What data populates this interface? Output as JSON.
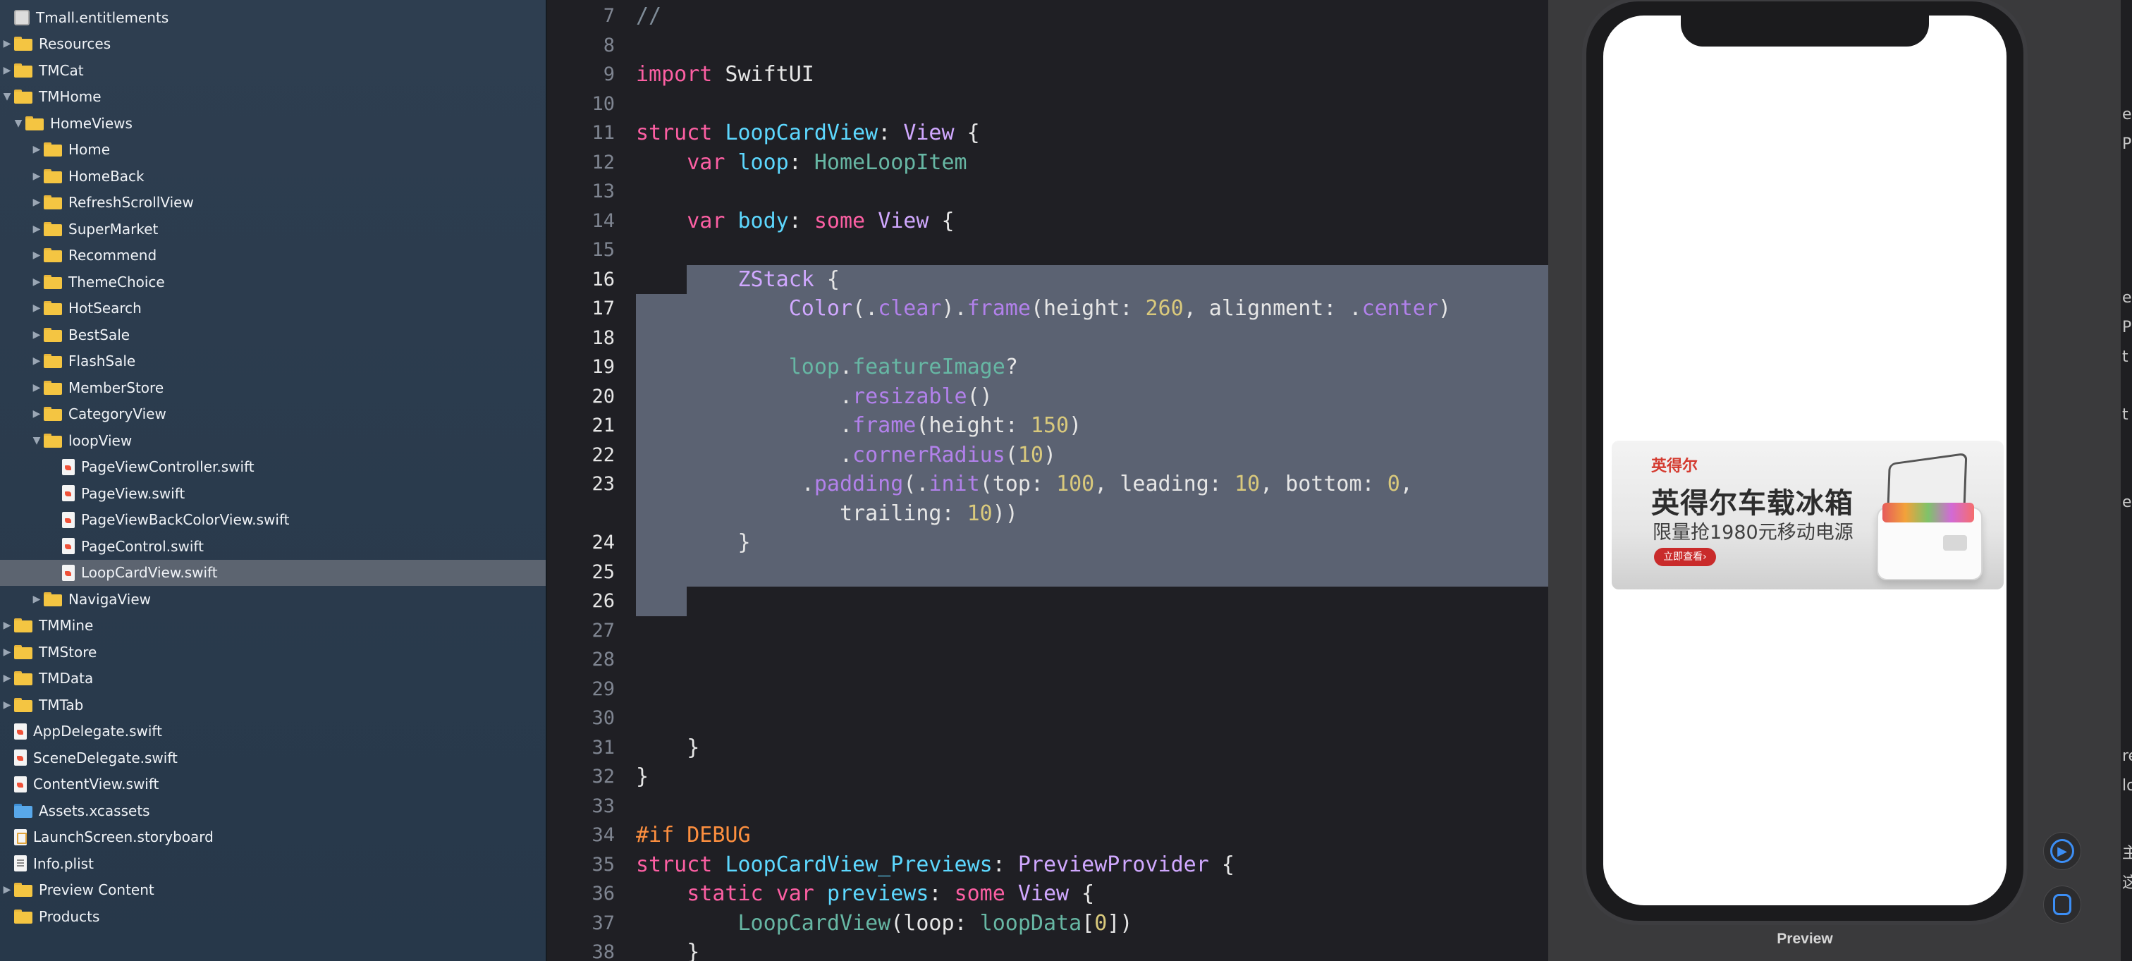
{
  "navigator": {
    "items": [
      {
        "label": "Tmall.entitlements",
        "indent": 0,
        "icon": "entitlements-icon",
        "disclosure": "none"
      },
      {
        "label": "Resources",
        "indent": 0,
        "icon": "folder-icon",
        "disclosure": "collapsed"
      },
      {
        "label": "TMCat",
        "indent": 0,
        "icon": "folder-icon",
        "disclosure": "collapsed"
      },
      {
        "label": "TMHome",
        "indent": 0,
        "icon": "folder-icon",
        "disclosure": "expanded"
      },
      {
        "label": "HomeViews",
        "indent": 1,
        "icon": "folder-icon",
        "disclosure": "expanded"
      },
      {
        "label": "Home",
        "indent": 2,
        "icon": "folder-icon",
        "disclosure": "collapsed"
      },
      {
        "label": "HomeBack",
        "indent": 2,
        "icon": "folder-icon",
        "disclosure": "collapsed"
      },
      {
        "label": "RefreshScrollView",
        "indent": 2,
        "icon": "folder-icon",
        "disclosure": "collapsed"
      },
      {
        "label": "SuperMarket",
        "indent": 2,
        "icon": "folder-icon",
        "disclosure": "collapsed"
      },
      {
        "label": "Recommend",
        "indent": 2,
        "icon": "folder-icon",
        "disclosure": "collapsed"
      },
      {
        "label": "ThemeChoice",
        "indent": 2,
        "icon": "folder-icon",
        "disclosure": "collapsed"
      },
      {
        "label": "HotSearch",
        "indent": 2,
        "icon": "folder-icon",
        "disclosure": "collapsed"
      },
      {
        "label": "BestSale",
        "indent": 2,
        "icon": "folder-icon",
        "disclosure": "collapsed"
      },
      {
        "label": "FlashSale",
        "indent": 2,
        "icon": "folder-icon",
        "disclosure": "collapsed"
      },
      {
        "label": "MemberStore",
        "indent": 2,
        "icon": "folder-icon",
        "disclosure": "collapsed"
      },
      {
        "label": "CategoryView",
        "indent": 2,
        "icon": "folder-icon",
        "disclosure": "collapsed"
      },
      {
        "label": "loopView",
        "indent": 2,
        "icon": "folder-icon",
        "disclosure": "expanded"
      },
      {
        "label": "PageViewController.swift",
        "indent": 3,
        "icon": "swift-file-icon",
        "disclosure": "none"
      },
      {
        "label": "PageView.swift",
        "indent": 3,
        "icon": "swift-file-icon",
        "disclosure": "none"
      },
      {
        "label": "PageViewBackColorView.swift",
        "indent": 3,
        "icon": "swift-file-icon",
        "disclosure": "none"
      },
      {
        "label": "PageControl.swift",
        "indent": 3,
        "icon": "swift-file-icon",
        "disclosure": "none"
      },
      {
        "label": "LoopCardView.swift",
        "indent": 3,
        "icon": "swift-file-icon",
        "disclosure": "none",
        "selected": true
      },
      {
        "label": "NavigaView",
        "indent": 2,
        "icon": "folder-icon",
        "disclosure": "collapsed"
      },
      {
        "label": "TMMine",
        "indent": 0,
        "icon": "folder-icon",
        "disclosure": "collapsed"
      },
      {
        "label": "TMStore",
        "indent": 0,
        "icon": "folder-icon",
        "disclosure": "collapsed"
      },
      {
        "label": "TMData",
        "indent": 0,
        "icon": "folder-icon",
        "disclosure": "collapsed"
      },
      {
        "label": "TMTab",
        "indent": 0,
        "icon": "folder-icon",
        "disclosure": "collapsed"
      },
      {
        "label": "AppDelegate.swift",
        "indent": 0,
        "icon": "swift-file-icon",
        "disclosure": "none"
      },
      {
        "label": "SceneDelegate.swift",
        "indent": 0,
        "icon": "swift-file-icon",
        "disclosure": "none"
      },
      {
        "label": "ContentView.swift",
        "indent": 0,
        "icon": "swift-file-icon",
        "disclosure": "none"
      },
      {
        "label": "Assets.xcassets",
        "indent": 0,
        "icon": "asset-catalog-icon",
        "disclosure": "none"
      },
      {
        "label": "LaunchScreen.storyboard",
        "indent": 0,
        "icon": "storyboard-icon",
        "disclosure": "none"
      },
      {
        "label": "Info.plist",
        "indent": 0,
        "icon": "plist-file-icon",
        "disclosure": "none"
      },
      {
        "label": "Preview Content",
        "indent": 0,
        "icon": "folder-icon",
        "disclosure": "collapsed"
      },
      {
        "label": "Products",
        "indent": 0,
        "icon": "folder-icon",
        "disclosure": "none"
      }
    ]
  },
  "editor": {
    "selected_lines": [
      16,
      17,
      18,
      19,
      20,
      21,
      22,
      23,
      24,
      25,
      26
    ],
    "lines": [
      {
        "num": "7",
        "tokens": [
          [
            "cm",
            "//"
          ]
        ]
      },
      {
        "num": "8",
        "tokens": []
      },
      {
        "num": "9",
        "tokens": [
          [
            "kw",
            "import"
          ],
          [
            "pl",
            " SwiftUI"
          ]
        ]
      },
      {
        "num": "10",
        "tokens": []
      },
      {
        "num": "11",
        "tokens": [
          [
            "kw",
            "struct"
          ],
          [
            "pl",
            " "
          ],
          [
            "decl",
            "LoopCardView"
          ],
          [
            "pl",
            ": "
          ],
          [
            "type",
            "View"
          ],
          [
            "pl",
            " {"
          ]
        ]
      },
      {
        "num": "12",
        "tokens": [
          [
            "pl",
            "    "
          ],
          [
            "kw",
            "var"
          ],
          [
            "pl",
            " "
          ],
          [
            "decl",
            "loop"
          ],
          [
            "pl",
            ": "
          ],
          [
            "id",
            "HomeLoopItem"
          ]
        ]
      },
      {
        "num": "13",
        "tokens": []
      },
      {
        "num": "14",
        "tokens": [
          [
            "pl",
            "    "
          ],
          [
            "kw",
            "var"
          ],
          [
            "pl",
            " "
          ],
          [
            "decl",
            "body"
          ],
          [
            "pl",
            ": "
          ],
          [
            "kw",
            "some"
          ],
          [
            "pl",
            " "
          ],
          [
            "type",
            "View"
          ],
          [
            "pl",
            " {"
          ]
        ]
      },
      {
        "num": "15",
        "tokens": []
      },
      {
        "num": "16",
        "tokens": [
          [
            "pl",
            "        "
          ],
          [
            "type",
            "ZStack"
          ],
          [
            "pl",
            " {"
          ]
        ]
      },
      {
        "num": "17",
        "tokens": [
          [
            "pl",
            "            "
          ],
          [
            "type",
            "Color"
          ],
          [
            "pl",
            "(."
          ],
          [
            "mem",
            "clear"
          ],
          [
            "pl",
            ")."
          ],
          [
            "mem",
            "frame"
          ],
          [
            "pl",
            "(height: "
          ],
          [
            "num",
            "260"
          ],
          [
            "pl",
            ", alignment: ."
          ],
          [
            "mem",
            "center"
          ],
          [
            "pl",
            ")"
          ]
        ]
      },
      {
        "num": "18",
        "tokens": []
      },
      {
        "num": "19",
        "tokens": [
          [
            "pl",
            "            "
          ],
          [
            "id",
            "loop"
          ],
          [
            "pl",
            "."
          ],
          [
            "id",
            "featureImage"
          ],
          [
            "pl",
            "?"
          ]
        ]
      },
      {
        "num": "20",
        "tokens": [
          [
            "pl",
            "                ."
          ],
          [
            "mem",
            "resizable"
          ],
          [
            "pl",
            "()"
          ]
        ]
      },
      {
        "num": "21",
        "tokens": [
          [
            "pl",
            "                ."
          ],
          [
            "mem",
            "frame"
          ],
          [
            "pl",
            "(height: "
          ],
          [
            "num",
            "150"
          ],
          [
            "pl",
            ")"
          ]
        ]
      },
      {
        "num": "22",
        "tokens": [
          [
            "pl",
            "                ."
          ],
          [
            "mem",
            "cornerRadius"
          ],
          [
            "pl",
            "("
          ],
          [
            "num",
            "10"
          ],
          [
            "pl",
            ")"
          ]
        ]
      },
      {
        "num": "23",
        "tokens": [
          [
            "pl",
            "             ."
          ],
          [
            "mem",
            "padding"
          ],
          [
            "pl",
            "(."
          ],
          [
            "mem",
            "init"
          ],
          [
            "pl",
            "(top: "
          ],
          [
            "num",
            "100"
          ],
          [
            "pl",
            ", leading: "
          ],
          [
            "num",
            "10"
          ],
          [
            "pl",
            ", bottom: "
          ],
          [
            "num",
            "0"
          ],
          [
            "pl",
            ","
          ]
        ]
      },
      {
        "num": "",
        "tokens": [
          [
            "pl",
            "                trailing: "
          ],
          [
            "num",
            "10"
          ],
          [
            "pl",
            "))"
          ]
        ]
      },
      {
        "num": "24",
        "tokens": [
          [
            "pl",
            "        }"
          ]
        ]
      },
      {
        "num": "25",
        "tokens": []
      },
      {
        "num": "26",
        "tokens": []
      },
      {
        "num": "27",
        "tokens": []
      },
      {
        "num": "28",
        "tokens": []
      },
      {
        "num": "29",
        "tokens": []
      },
      {
        "num": "30",
        "tokens": []
      },
      {
        "num": "31",
        "tokens": [
          [
            "pl",
            "    }"
          ]
        ]
      },
      {
        "num": "32",
        "tokens": [
          [
            "pl",
            "}"
          ]
        ]
      },
      {
        "num": "33",
        "tokens": []
      },
      {
        "num": "34",
        "tokens": [
          [
            "pp",
            "#if DEBUG"
          ]
        ]
      },
      {
        "num": "35",
        "tokens": [
          [
            "kw",
            "struct"
          ],
          [
            "pl",
            " "
          ],
          [
            "decl",
            "LoopCardView_Previews"
          ],
          [
            "pl",
            ": "
          ],
          [
            "type",
            "PreviewProvider"
          ],
          [
            "pl",
            " {"
          ]
        ]
      },
      {
        "num": "36",
        "tokens": [
          [
            "pl",
            "    "
          ],
          [
            "kw",
            "static"
          ],
          [
            "pl",
            " "
          ],
          [
            "kw",
            "var"
          ],
          [
            "pl",
            " "
          ],
          [
            "decl",
            "previews"
          ],
          [
            "pl",
            ": "
          ],
          [
            "kw",
            "some"
          ],
          [
            "pl",
            " "
          ],
          [
            "type",
            "View"
          ],
          [
            "pl",
            " {"
          ]
        ]
      },
      {
        "num": "37",
        "tokens": [
          [
            "pl",
            "        "
          ],
          [
            "id",
            "LoopCardView"
          ],
          [
            "pl",
            "(loop: "
          ],
          [
            "id",
            "loopData"
          ],
          [
            "pl",
            "["
          ],
          [
            "num",
            "0"
          ],
          [
            "pl",
            "])"
          ]
        ]
      },
      {
        "num": "38",
        "tokens": [
          [
            "pl",
            "    }"
          ]
        ]
      }
    ]
  },
  "preview": {
    "label": "Preview",
    "banner": {
      "brand": "英得尔",
      "headline": "英得尔车载冰箱",
      "subline": "限量抢1980元移动电源",
      "cta": "立即查看›"
    },
    "controls": [
      {
        "name": "live-preview-button",
        "icon": "play-icon"
      },
      {
        "name": "preview-on-device-button",
        "icon": "device-icon"
      }
    ]
  },
  "inspector_edge_chars": [
    "e",
    "P",
    "e",
    "P",
    "t",
    "t",
    "e",
    "re",
    "lo",
    "主",
    "这"
  ],
  "colors": {
    "keyword": "#fc5fa3",
    "type": "#d0a8ff",
    "declaration": "#5dd8ff",
    "identifier": "#67b7a4",
    "member": "#b281eb",
    "number": "#d9c97c",
    "comment": "#7f8c98",
    "preprocessor": "#fd8f3f",
    "selection": "#5b6272",
    "accent": "#3c8ef5"
  }
}
